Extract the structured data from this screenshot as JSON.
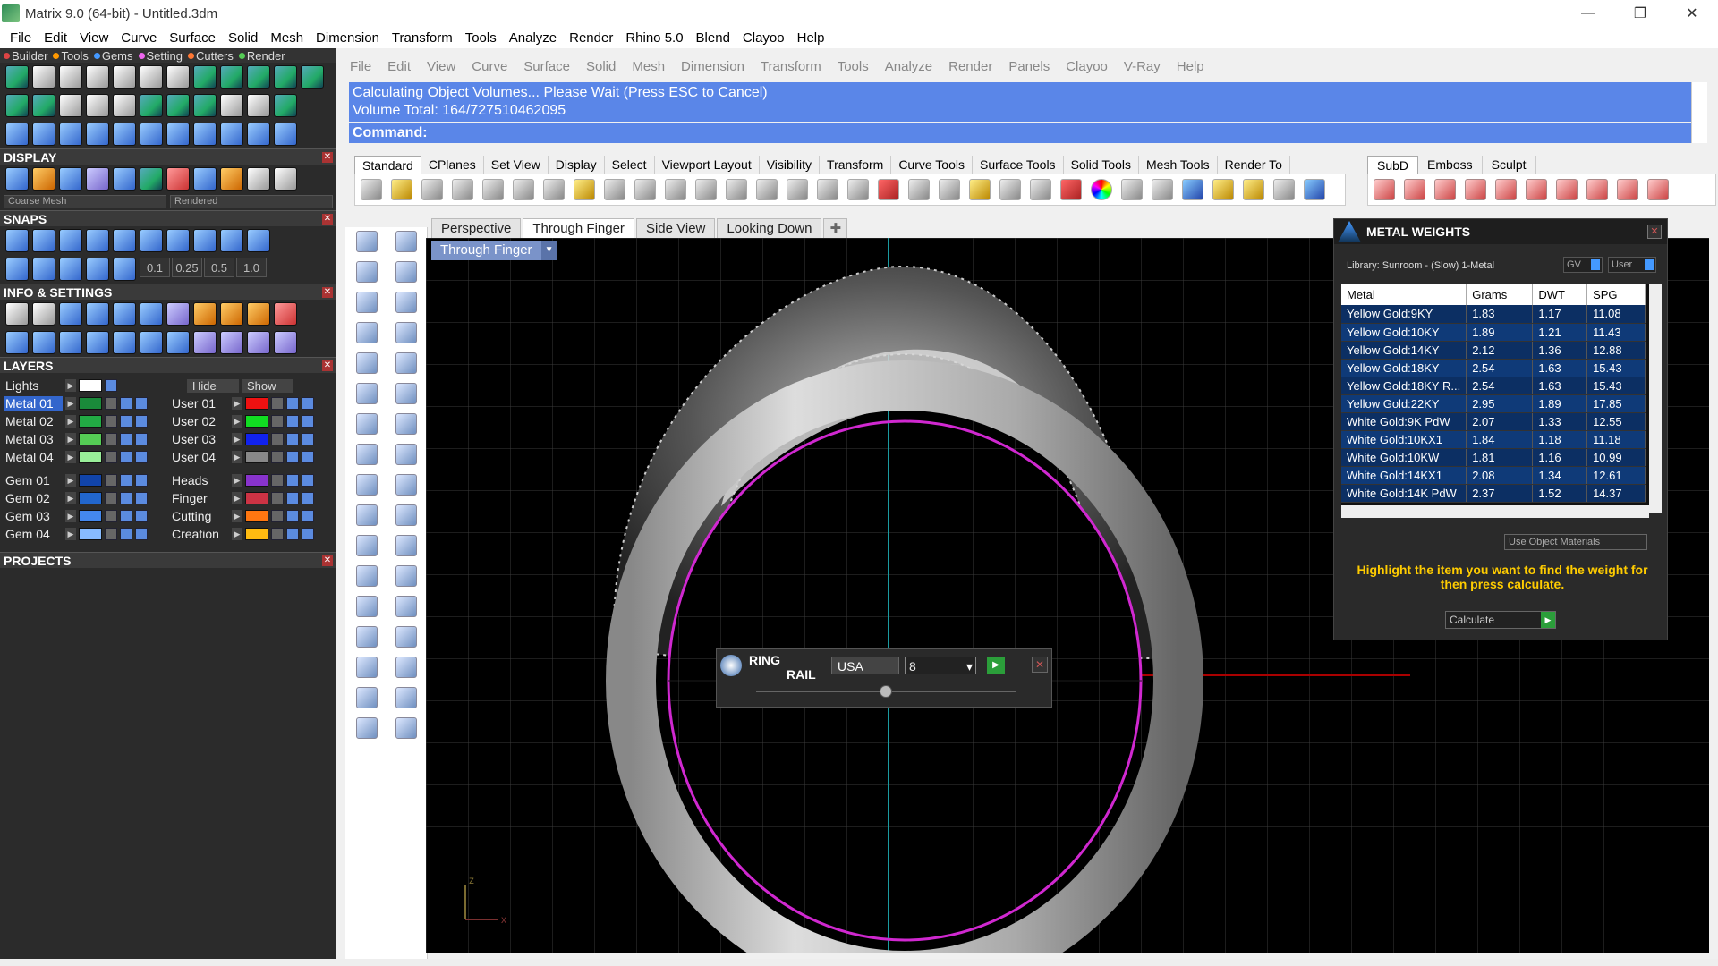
{
  "window": {
    "title": "Matrix 9.0 (64-bit) - Untitled.3dm",
    "minimize": "—",
    "maximize": "❐",
    "close": "✕"
  },
  "main_menu": [
    "File",
    "Edit",
    "View",
    "Curve",
    "Surface",
    "Solid",
    "Mesh",
    "Dimension",
    "Transform",
    "Tools",
    "Analyze",
    "Render",
    "Rhino 5.0",
    "Blend",
    "Clayoo",
    "Help"
  ],
  "left_panel": {
    "tabs": [
      "Builder",
      "Tools",
      "Gems",
      "Setting",
      "Cutters",
      "Render"
    ],
    "display": {
      "header": "DISPLAY",
      "mesh_quality": "Coarse Mesh",
      "display_mode": "Rendered"
    },
    "snaps": {
      "header": "SNAPS",
      "values": [
        "0.1",
        "0.25",
        "0.5",
        "1.0"
      ]
    },
    "info": {
      "header": "INFO & SETTINGS"
    },
    "layers": {
      "header": "LAYERS",
      "lights_label": "Lights",
      "hide_label": "Hide",
      "show_label": "Show",
      "left": [
        {
          "name": "Metal 01",
          "color": "#1a8a3a",
          "selected": true
        },
        {
          "name": "Metal 02",
          "color": "#22aa44"
        },
        {
          "name": "Metal 03",
          "color": "#55cc55"
        },
        {
          "name": "Metal 04",
          "color": "#99ee99"
        },
        {
          "name": "Gem 01",
          "color": "#1144aa"
        },
        {
          "name": "Gem 02",
          "color": "#2266cc"
        },
        {
          "name": "Gem 03",
          "color": "#4488ee"
        },
        {
          "name": "Gem 04",
          "color": "#88bbff"
        }
      ],
      "right": [
        {
          "name": "User 01",
          "color": "#ee1111"
        },
        {
          "name": "User 02",
          "color": "#11dd22"
        },
        {
          "name": "User 03",
          "color": "#1122ee"
        },
        {
          "name": "User 04",
          "color": "#888888"
        },
        {
          "name": "Heads",
          "color": "#8833cc"
        },
        {
          "name": "Finger",
          "color": "#cc3344"
        },
        {
          "name": "Cutting",
          "color": "#ff7711"
        },
        {
          "name": "Creation",
          "color": "#ffbb11"
        }
      ]
    },
    "projects": {
      "header": "PROJECTS"
    }
  },
  "rhino_menu": [
    "File",
    "Edit",
    "View",
    "Curve",
    "Surface",
    "Solid",
    "Mesh",
    "Dimension",
    "Transform",
    "Tools",
    "Analyze",
    "Render",
    "Panels",
    "Clayoo",
    "V-Ray",
    "Help"
  ],
  "command": {
    "history_line1": "Calculating Object Volumes... Please Wait (Press ESC to Cancel)",
    "history_line2": "Volume Total: 164/727510462095",
    "prompt": "Command:"
  },
  "toolbar_tabs": [
    "Standard",
    "CPlanes",
    "Set View",
    "Display",
    "Select",
    "Viewport Layout",
    "Visibility",
    "Transform",
    "Curve Tools",
    "Surface Tools",
    "Solid Tools",
    "Mesh Tools",
    "Render To"
  ],
  "toolbar_tabs_right": [
    "SubD",
    "Emboss",
    "Sculpt"
  ],
  "viewport_tabs": [
    "Perspective",
    "Through Finger",
    "Side View",
    "Looking Down"
  ],
  "viewport": {
    "title": "Through Finger",
    "axis_z": "z",
    "axis_x": "x"
  },
  "ring_rail": {
    "title_line1": "RING",
    "title_line2": "RAIL",
    "size_system": "USA",
    "size_value": "8"
  },
  "metal_weights": {
    "title": "METAL WEIGHTS",
    "library": "Library: Sunroom - (Slow) 1-Metal",
    "gv_label": "GV",
    "user_label": "User",
    "columns": [
      "Metal",
      "Grams",
      "DWT",
      "SPG"
    ],
    "rows": [
      [
        "Yellow Gold:9KY",
        "1.83",
        "1.17",
        "11.08"
      ],
      [
        "Yellow Gold:10KY",
        "1.89",
        "1.21",
        "11.43"
      ],
      [
        "Yellow Gold:14KY",
        "2.12",
        "1.36",
        "12.88"
      ],
      [
        "Yellow Gold:18KY",
        "2.54",
        "1.63",
        "15.43"
      ],
      [
        "Yellow Gold:18KY R...",
        "2.54",
        "1.63",
        "15.43"
      ],
      [
        "Yellow Gold:22KY",
        "2.95",
        "1.89",
        "17.85"
      ],
      [
        "White Gold:9K PdW",
        "2.07",
        "1.33",
        "12.55"
      ],
      [
        "White Gold:10KX1",
        "1.84",
        "1.18",
        "11.18"
      ],
      [
        "White Gold:10KW",
        "1.81",
        "1.16",
        "10.99"
      ],
      [
        "White Gold:14KX1",
        "2.08",
        "1.34",
        "12.61"
      ],
      [
        "White Gold:14K PdW",
        "2.37",
        "1.52",
        "14.37"
      ]
    ],
    "use_object_materials": "Use Object Materials",
    "hint": "Highlight the item you want to find the weight for then press calculate.",
    "calculate": "Calculate"
  }
}
